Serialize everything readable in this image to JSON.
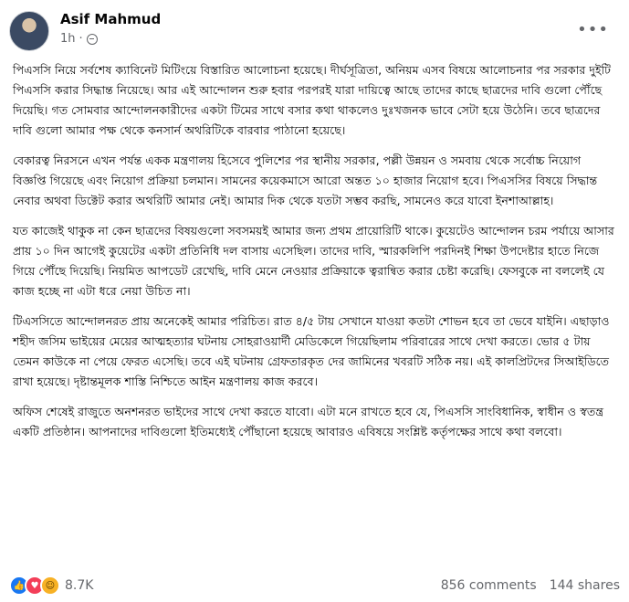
{
  "author": {
    "name": "Asif Mahmud",
    "time": "1h",
    "privacy_icon": "globe-icon"
  },
  "post": {
    "paragraphs": [
      "পিএসসি নিয়ে সর্বশেষ ক্যাবিনেট মিটিংয়ে বিস্তারিত আলোচনা হয়েছে। দীর্ঘসূত্রিতা, অনিয়ম এসব বিষয়ে আলোচনার পর সরকার দুইটি পিএসসি করার সিদ্ধান্ত নিয়েছে। আর এই আন্দোলন শুরু হবার পরপরই যারা দায়িত্বে আছে তাদের কাছে ছাত্রদের দাবি গুলো পৌঁছে দিয়েছি। গত সোমবার আন্দোলনকারীদের একটা টিমের সাথে বসার কথা থাকলেও দুঃখজনক ভাবে সেটা হয়ে উঠেনি। তবে ছাত্রদের দাবি গুলো আমার পক্ষ থেকে কনসার্ন অথরিটিকে বারবার পাঠানো হয়েছে।",
      "বেকারত্ব নিরসনে এখন পর্যন্ত একক মন্ত্রণালয় হিসেবে পুলিশের পর স্থানীয় সরকার, পল্লী উন্নয়ন ও সমবায় থেকে সর্বোচ্চ নিয়োগ বিজ্ঞপ্তি গিয়েছে এবং নিয়োগ প্রক্রিয়া চলমান। সামনের কয়েকমাসে আরো অন্তত ১০ হাজার নিয়োগ হবে। পিএসসির বিষয়ে সিদ্ধান্ত নেবার অথবা ডিক্টেট করার অথরিটি আমার নেই। আমার দিক থেকে যতটা সম্ভব করছি, সামনেও করে যাবো ইনশাআল্লাহ।",
      "যত কাজেই থাকুক না কেন ছাত্রদের বিষয়গুলো সবসময়ই আমার জন্য প্রথম প্রায়োরিটি থাকে। কুয়েটেও আন্দোলন চরম পর্যায়ে আসার প্রায় ১০ দিন আগেই কুয়েটের একটা প্রতিনিধি দল বাসায় এসেছিল। তাদের দাবি, স্মারকলিপি পরদিনই শিক্ষা উপদেষ্টার হাতে নিজে গিয়ে পৌঁছে দিয়েছি। নিয়মিত আপডেট রেখেছি, দাবি মেনে নেওয়ার প্রক্রিয়াকে ত্বরান্বিত করার চেষ্টা করেছি। ফেসবুকে না বললেই যে কাজ হচ্ছে না এটা ধরে নেয়া উচিত না।",
      "টিএসসিতে আন্দোলনরত প্রায় অনেকেই আমার পরিচিত। রাত ৪/৫ টায় সেখানে যাওয়া কতটা শোভন হবে তা ভেবে যাইনি। এছাড়াও শহীদ জসিম ভাইয়ের মেয়ের আত্মহত্যার ঘটনায় সোহরাওয়ার্দী মেডিকেলে গিয়েছিলাম পরিবারের সাথে দেখা করতে। ভোর ৫ টায় তেমন কাউকে না পেয়ে ফেরত এসেছি। তবে এই ঘটনায় গ্রেফতারকৃত দের জামিনের খবরটি সঠিক নয়। এই কালপ্রিটদের সিআইডিতে রাখা হয়েছে। দৃষ্টান্তমূলক শাস্তি নিশ্চিতে আইন মন্ত্রণালয় কাজ করবে।",
      "অফিস শেষেই রাজুতে অনশনরত ভাইদের সাথে দেখা করতে যাবো। এটা মনে রাখতে হবে যে, পিএসসি সাংবিধানিক, স্বাধীন ও স্বতন্ত্র একটি প্রতিষ্ঠান। আপনাদের দাবিগুলো ইতিমধ্যেই পৌঁছানো হয়েছে আবারও এবিষয়ে সংশ্লিষ্ট কর্তৃপক্ষের সাথে কথা বলবো।"
    ]
  },
  "engagement": {
    "reaction_icons": [
      "like-icon",
      "love-icon",
      "haha-icon"
    ],
    "reaction_count": "8.7K",
    "comments": "856 comments",
    "shares": "144 shares"
  }
}
